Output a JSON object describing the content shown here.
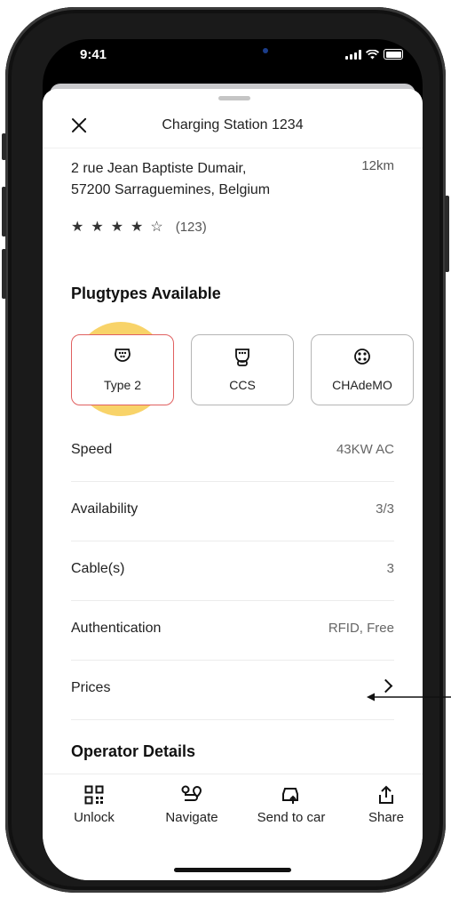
{
  "status_bar": {
    "time": "9:41"
  },
  "header": {
    "title": "Charging Station 1234"
  },
  "station": {
    "address_line1": "2 rue Jean Baptiste Dumair,",
    "address_line2": "57200 Sarraguemines, Belgium",
    "distance": "12km",
    "rating_stars": 4,
    "rating_max": 5,
    "review_count": "(123)"
  },
  "plugtypes": {
    "heading": "Plugtypes Available",
    "items": [
      {
        "label": "Type 2",
        "icon": "type2-plug-icon",
        "selected": true
      },
      {
        "label": "CCS",
        "icon": "ccs-plug-icon",
        "selected": false
      },
      {
        "label": "CHAdeMO",
        "icon": "chademo-plug-icon",
        "selected": false
      }
    ]
  },
  "details": [
    {
      "label": "Speed",
      "value": "43KW AC"
    },
    {
      "label": "Availability",
      "value": "3/3"
    },
    {
      "label": "Cable(s)",
      "value": "3"
    },
    {
      "label": "Authentication",
      "value": "RFID, Free"
    },
    {
      "label": "Prices",
      "value": ""
    }
  ],
  "operator": {
    "heading": "Operator Details"
  },
  "actions": [
    {
      "label": "Unlock",
      "icon": "qr-code-icon"
    },
    {
      "label": "Navigate",
      "icon": "route-icon"
    },
    {
      "label": "Send to car",
      "icon": "send-to-car-icon"
    },
    {
      "label": "Share",
      "icon": "share-icon"
    }
  ],
  "colors": {
    "selected_border": "#e06060",
    "tap_highlight": "#f7c948"
  }
}
